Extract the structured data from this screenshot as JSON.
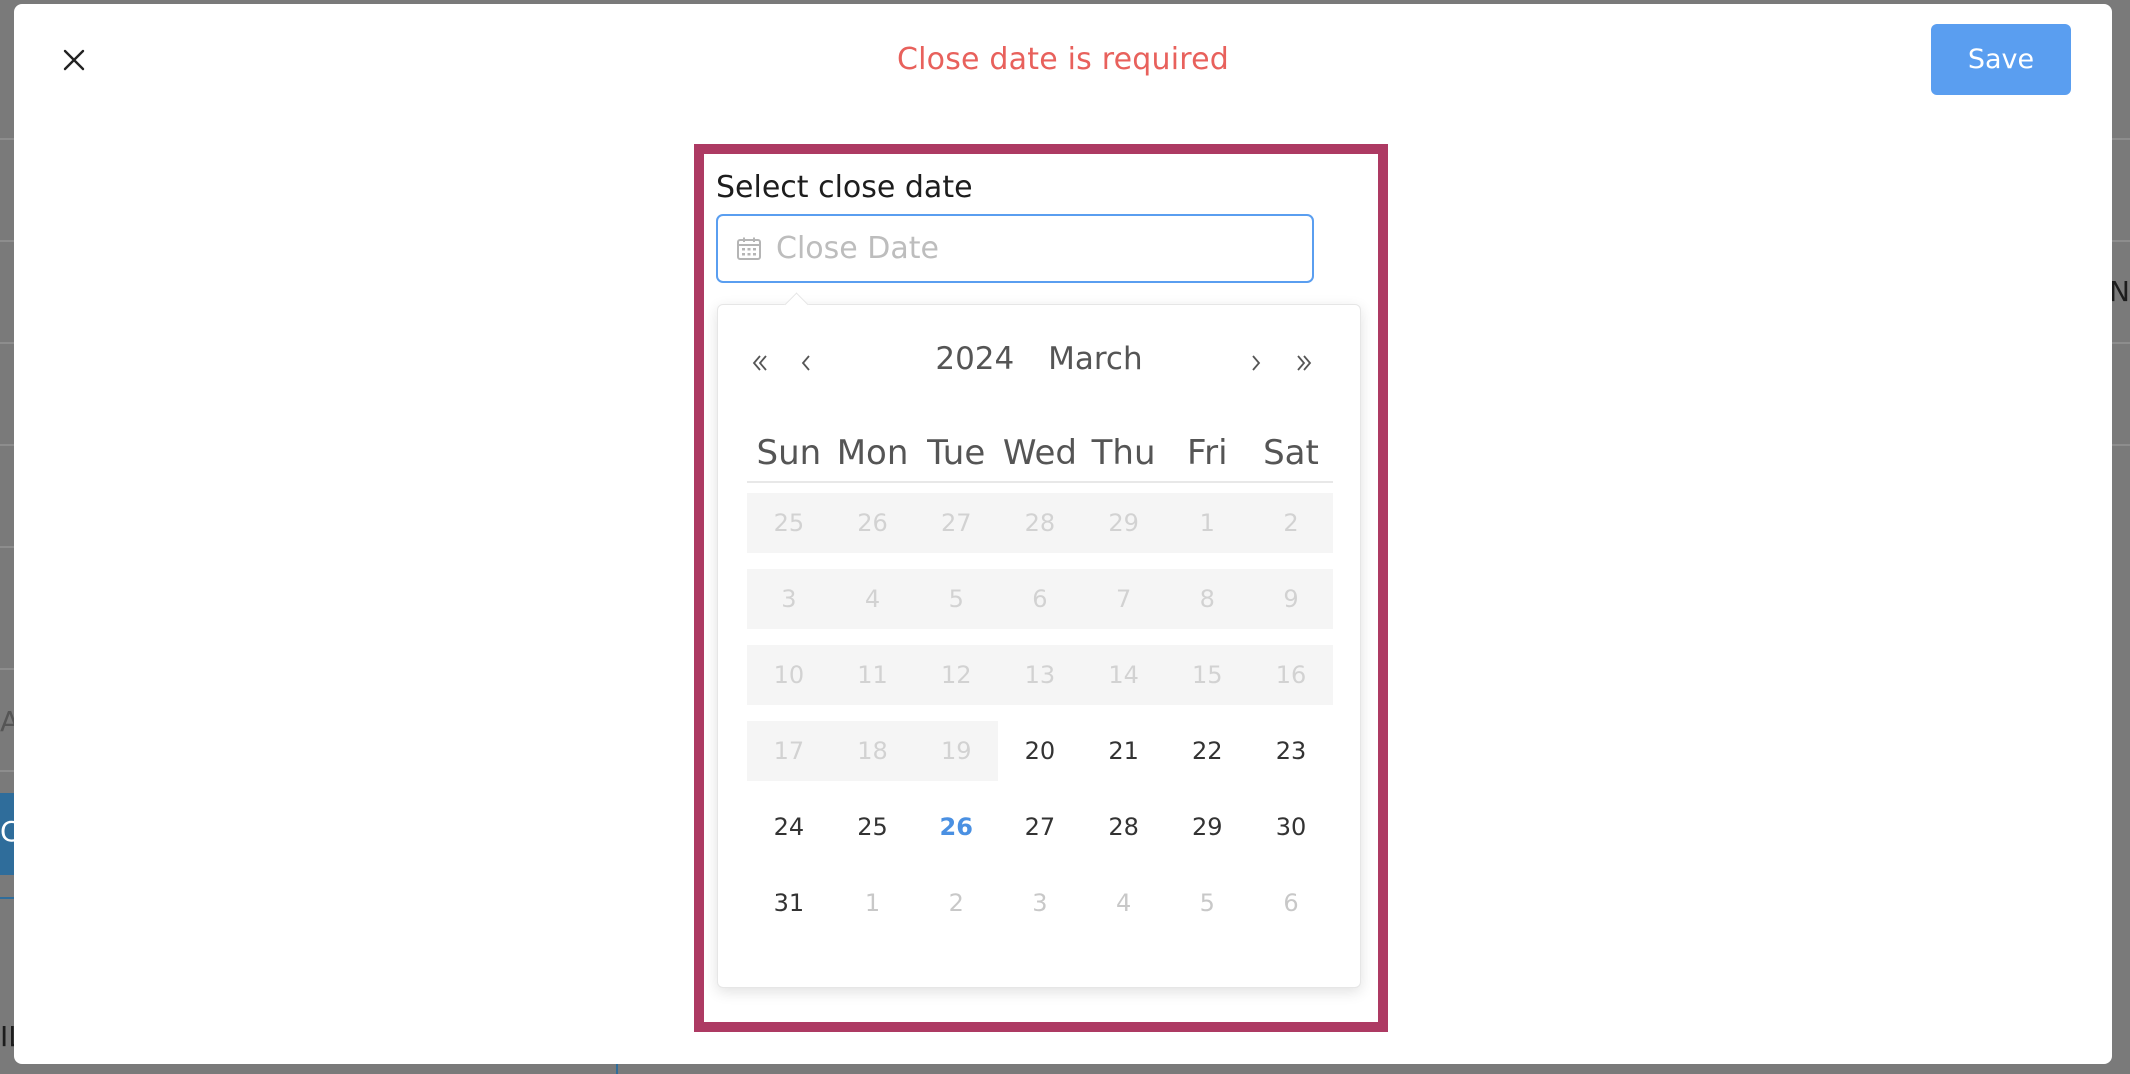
{
  "modal": {
    "error_text": "Close date is required",
    "save_label": "Save"
  },
  "field": {
    "label": "Select close date",
    "placeholder": "Close Date",
    "value": ""
  },
  "calendar": {
    "year": "2024",
    "month": "March",
    "weekdays": [
      "Sun",
      "Mon",
      "Tue",
      "Wed",
      "Thu",
      "Fri",
      "Sat"
    ],
    "weeks": [
      [
        {
          "d": "25",
          "s": "disabled"
        },
        {
          "d": "26",
          "s": "disabled"
        },
        {
          "d": "27",
          "s": "disabled"
        },
        {
          "d": "28",
          "s": "disabled"
        },
        {
          "d": "29",
          "s": "disabled"
        },
        {
          "d": "1",
          "s": "disabled"
        },
        {
          "d": "2",
          "s": "disabled"
        }
      ],
      [
        {
          "d": "3",
          "s": "disabled"
        },
        {
          "d": "4",
          "s": "disabled"
        },
        {
          "d": "5",
          "s": "disabled"
        },
        {
          "d": "6",
          "s": "disabled"
        },
        {
          "d": "7",
          "s": "disabled"
        },
        {
          "d": "8",
          "s": "disabled"
        },
        {
          "d": "9",
          "s": "disabled"
        }
      ],
      [
        {
          "d": "10",
          "s": "disabled"
        },
        {
          "d": "11",
          "s": "disabled"
        },
        {
          "d": "12",
          "s": "disabled"
        },
        {
          "d": "13",
          "s": "disabled"
        },
        {
          "d": "14",
          "s": "disabled"
        },
        {
          "d": "15",
          "s": "disabled"
        },
        {
          "d": "16",
          "s": "disabled"
        }
      ],
      [
        {
          "d": "17",
          "s": "disabled"
        },
        {
          "d": "18",
          "s": "disabled"
        },
        {
          "d": "19",
          "s": "disabled"
        },
        {
          "d": "20",
          "s": "normal"
        },
        {
          "d": "21",
          "s": "normal"
        },
        {
          "d": "22",
          "s": "normal"
        },
        {
          "d": "23",
          "s": "normal"
        }
      ],
      [
        {
          "d": "24",
          "s": "normal"
        },
        {
          "d": "25",
          "s": "normal"
        },
        {
          "d": "26",
          "s": "today"
        },
        {
          "d": "27",
          "s": "normal"
        },
        {
          "d": "28",
          "s": "normal"
        },
        {
          "d": "29",
          "s": "normal"
        },
        {
          "d": "30",
          "s": "normal"
        }
      ],
      [
        {
          "d": "31",
          "s": "normal"
        },
        {
          "d": "1",
          "s": "muted"
        },
        {
          "d": "2",
          "s": "muted"
        },
        {
          "d": "3",
          "s": "muted"
        },
        {
          "d": "4",
          "s": "muted"
        },
        {
          "d": "5",
          "s": "muted"
        },
        {
          "d": "6",
          "s": "muted"
        }
      ]
    ]
  },
  "background": {
    "fragment_right": "N",
    "fragment_left_1": "A",
    "fragment_left_2": "C",
    "fragment_bottom": "IL"
  },
  "icons": {
    "close": "close-icon",
    "calendar": "calendar-icon",
    "prev_year": "double-chevron-left-icon",
    "prev_month": "chevron-left-icon",
    "next_month": "chevron-right-icon",
    "next_year": "double-chevron-right-icon"
  },
  "colors": {
    "error": "#e8615c",
    "primary": "#5a9ef0",
    "highlight_frame": "#ad3a63",
    "today": "#4a90e2"
  }
}
